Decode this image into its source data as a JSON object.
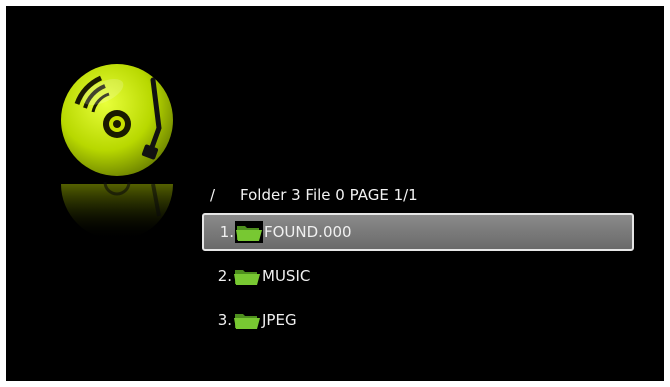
{
  "header": {
    "path": "/",
    "status": "Folder 3 File 0 PAGE 1/1"
  },
  "files": [
    {
      "index": "1.",
      "name": "FOUND.000",
      "icon": "folder-icon",
      "selected": true
    },
    {
      "index": "2.",
      "name": "MUSIC",
      "icon": "folder-icon",
      "selected": false
    },
    {
      "index": "3.",
      "name": "JPEG",
      "icon": "folder-icon",
      "selected": false
    }
  ],
  "colors": {
    "background": "#000000",
    "accent": "#c8e000",
    "folder": "#6fbf2a",
    "selection": "#7a7a7a"
  },
  "logo": {
    "icon": "music-disc-icon"
  }
}
